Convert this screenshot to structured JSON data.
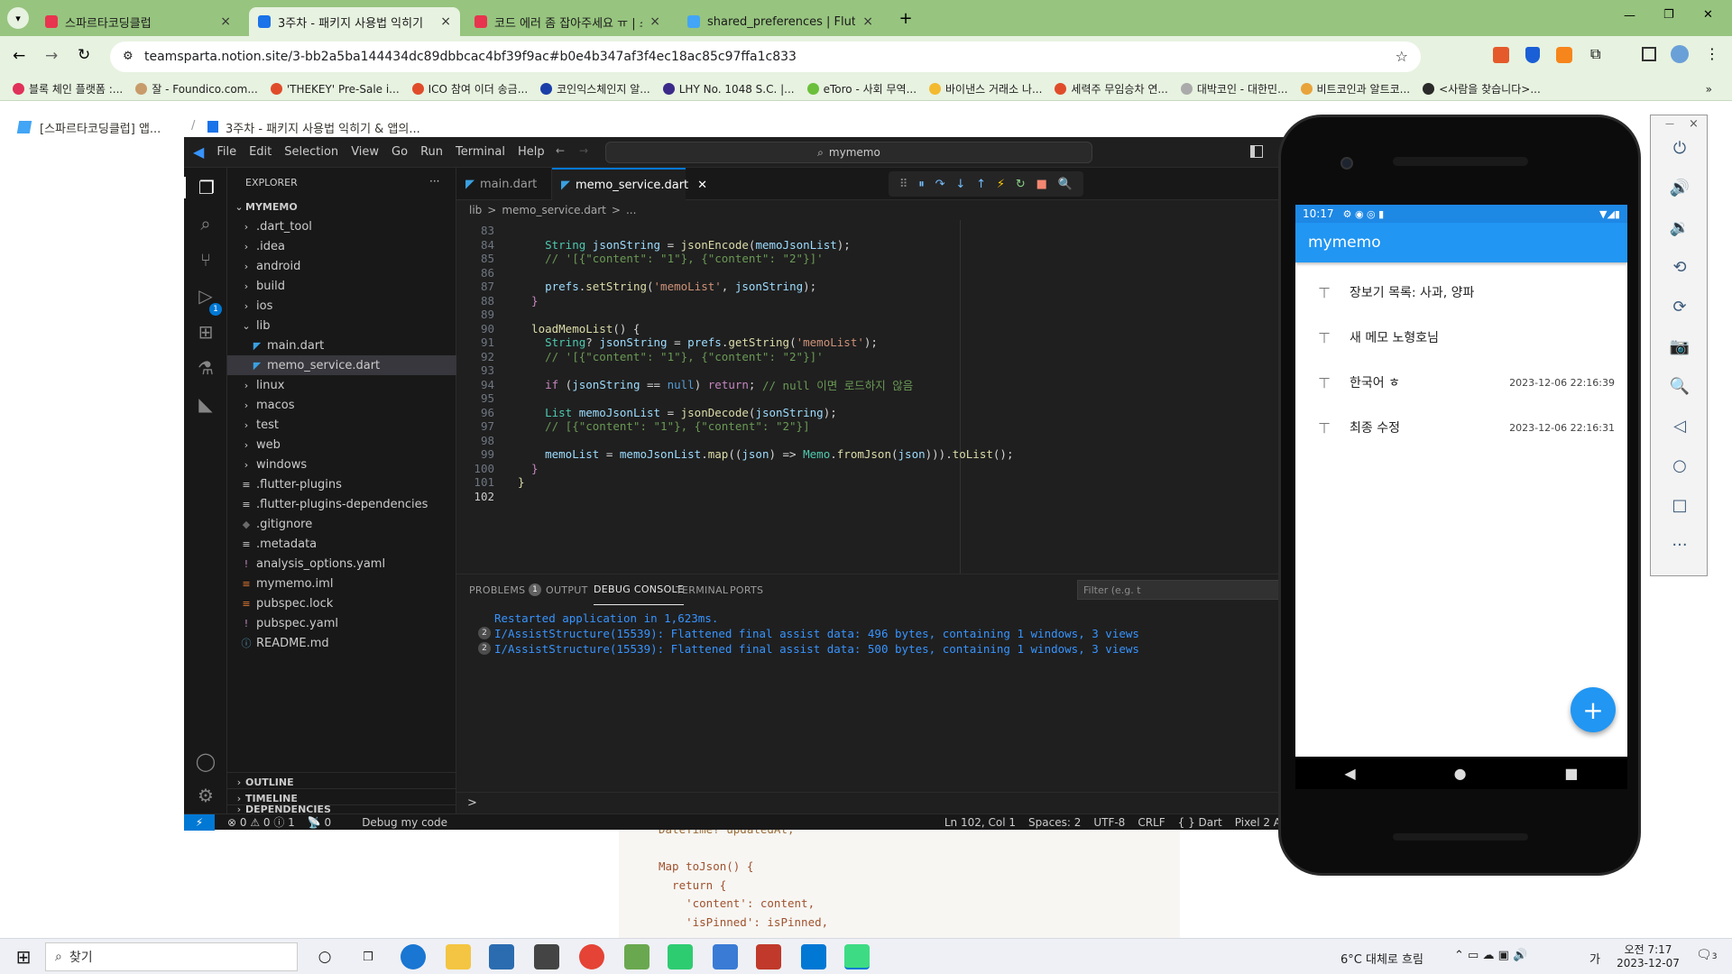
{
  "browser": {
    "tabs": [
      {
        "label": "스파르타코딩클럽",
        "color": "#e8344e"
      },
      {
        "label": "3주차 - 패키지 사용법 익히기",
        "color": "#1a73e8"
      },
      {
        "label": "코드 에러 좀 잡아주세요 ㅠ | 스",
        "color": "#e8344e"
      },
      {
        "label": "shared_preferences | Flutter Pa",
        "color": "#42a5f5"
      }
    ],
    "url": "teamsparta.notion.site/3-bb2a5ba144434dc89dbbcac4bf39f9ac#b0e4b347af3f4ec18ac85c97ffa1c833",
    "bookmarks": [
      {
        "label": "블록 체인 플랫폼 :...",
        "color": "#e0315a"
      },
      {
        "label": "잘 - Foundico.com...",
        "color": "#c89b6b"
      },
      {
        "label": "'THEKEY' Pre-Sale i...",
        "color": "#e04c2a"
      },
      {
        "label": "ICO 참여 이더 송금...",
        "color": "#e04c2a"
      },
      {
        "label": "코인익스체인지 알...",
        "color": "#1b3fa8"
      },
      {
        "label": "LHY No. 1048 S.C. |...",
        "color": "#3b2a8a"
      },
      {
        "label": "eToro - 사회 무역...",
        "color": "#6bbf3a"
      },
      {
        "label": "바이낸스 거래소 나...",
        "color": "#f3ba2f"
      },
      {
        "label": "세력주 무임승차 연...",
        "color": "#e04c2a"
      },
      {
        "label": "대박코인 - 대한민...",
        "color": "#aaaaaa"
      },
      {
        "label": "비트코인과 알트코...",
        "color": "#e8a33a"
      },
      {
        "label": "<사람을 찾습니다>...",
        "color": "#2a2a2a"
      }
    ],
    "tab_close": "×",
    "new_tab": "+",
    "win_min": "—",
    "win_restore": "❐",
    "win_close": "✕",
    "nav_back": "←",
    "nav_forward": "→",
    "nav_reload": "↻",
    "bookmark_more": "»"
  },
  "notion": {
    "breadcrumb_1": "[스파르타코딩클럽] 앱...",
    "breadcrumb_sep": "/",
    "breadcrumb_2": "3주차 - 패키지 사용법 익히기 & 앱의...",
    "code_lines": [
      "DateTime? updatedAt;",
      "",
      "Map toJson() {",
      "  return {",
      "    'content': content,",
      "    'isPinned': isPinned,"
    ]
  },
  "vscode": {
    "menu": [
      "File",
      "Edit",
      "Selection",
      "View",
      "Go",
      "Run",
      "Terminal",
      "Help"
    ],
    "command_center": "mymemo",
    "explorer_title": "EXPLORER",
    "explorer_more": "···",
    "project": "MYMEMO",
    "tree": [
      {
        "label": ".dart_tool",
        "type": "folder"
      },
      {
        "label": ".idea",
        "type": "folder"
      },
      {
        "label": "android",
        "type": "folder"
      },
      {
        "label": "build",
        "type": "folder"
      },
      {
        "label": "ios",
        "type": "folder"
      },
      {
        "label": "lib",
        "type": "folder-open"
      },
      {
        "label": "main.dart",
        "type": "dart"
      },
      {
        "label": "memo_service.dart",
        "type": "dart-sel"
      },
      {
        "label": "linux",
        "type": "folder"
      },
      {
        "label": "macos",
        "type": "folder"
      },
      {
        "label": "test",
        "type": "folder"
      },
      {
        "label": "web",
        "type": "folder"
      },
      {
        "label": "windows",
        "type": "folder"
      },
      {
        "label": ".flutter-plugins",
        "type": "file"
      },
      {
        "label": ".flutter-plugins-dependencies",
        "type": "file"
      },
      {
        "label": ".gitignore",
        "type": "git"
      },
      {
        "label": ".metadata",
        "type": "file"
      },
      {
        "label": "analysis_options.yaml",
        "type": "yaml"
      },
      {
        "label": "mymemo.iml",
        "type": "xml"
      },
      {
        "label": "pubspec.lock",
        "type": "xml"
      },
      {
        "label": "pubspec.yaml",
        "type": "yaml"
      },
      {
        "label": "README.md",
        "type": "info"
      }
    ],
    "sections": [
      "OUTLINE",
      "TIMELINE",
      "DEPENDENCIES"
    ],
    "tabs": [
      "main.dart",
      "memo_service.dart"
    ],
    "breadcrumb": [
      "lib",
      ">",
      "memo_service.dart",
      ">",
      "..."
    ],
    "code": [
      {
        "n": "83",
        "t": []
      },
      {
        "n": "84",
        "t": [
          [
            "ty",
            "    String "
          ],
          [
            "vr",
            "jsonString"
          ],
          [
            "pl",
            " = "
          ],
          [
            "fn",
            "jsonEncode"
          ],
          [
            "pl",
            "("
          ],
          [
            "vr",
            "memoJsonList"
          ],
          [
            "pl",
            ");"
          ]
        ]
      },
      {
        "n": "85",
        "t": [
          [
            "cm",
            "    // '[{\"content\": \"1\"}, {\"content\": \"2\"}]'"
          ]
        ]
      },
      {
        "n": "86",
        "t": []
      },
      {
        "n": "87",
        "t": [
          [
            "vr",
            "    prefs"
          ],
          [
            "pl",
            "."
          ],
          [
            "fn",
            "setString"
          ],
          [
            "pl",
            "("
          ],
          [
            "st",
            "'memoList'"
          ],
          [
            "pl",
            ", "
          ],
          [
            "vr",
            "jsonString"
          ],
          [
            "pl",
            ");"
          ]
        ]
      },
      {
        "n": "88",
        "t": [
          [
            "kc",
            "  }"
          ]
        ]
      },
      {
        "n": "89",
        "t": []
      },
      {
        "n": "90",
        "t": [
          [
            "fn",
            "  loadMemoList"
          ],
          [
            "pl",
            "() {"
          ]
        ]
      },
      {
        "n": "91",
        "t": [
          [
            "ty",
            "    String"
          ],
          [
            "pl",
            "? "
          ],
          [
            "vr",
            "jsonString"
          ],
          [
            "pl",
            " = "
          ],
          [
            "vr",
            "prefs"
          ],
          [
            "pl",
            "."
          ],
          [
            "fn",
            "getString"
          ],
          [
            "pl",
            "("
          ],
          [
            "st",
            "'memoList'"
          ],
          [
            "pl",
            ");"
          ]
        ]
      },
      {
        "n": "92",
        "t": [
          [
            "cm",
            "    // '[{\"content\": \"1\"}, {\"content\": \"2\"}]'"
          ]
        ]
      },
      {
        "n": "93",
        "t": []
      },
      {
        "n": "94",
        "t": [
          [
            "kc",
            "    if"
          ],
          [
            "pl",
            " ("
          ],
          [
            "vr",
            "jsonString"
          ],
          [
            "pl",
            " == "
          ],
          [
            "kw",
            "null"
          ],
          [
            "pl",
            ") "
          ],
          [
            "kc",
            "return"
          ],
          [
            "pl",
            "; "
          ],
          [
            "cm",
            "// null 이면 로드하지 않음"
          ]
        ]
      },
      {
        "n": "95",
        "t": []
      },
      {
        "n": "96",
        "t": [
          [
            "ty",
            "    List "
          ],
          [
            "vr",
            "memoJsonList"
          ],
          [
            "pl",
            " = "
          ],
          [
            "fn",
            "jsonDecode"
          ],
          [
            "pl",
            "("
          ],
          [
            "vr",
            "jsonString"
          ],
          [
            "pl",
            ");"
          ]
        ]
      },
      {
        "n": "97",
        "t": [
          [
            "cm",
            "    // [{\"content\": \"1\"}, {\"content\": \"2\"}]"
          ]
        ]
      },
      {
        "n": "98",
        "t": []
      },
      {
        "n": "99",
        "t": [
          [
            "vr",
            "    memoList"
          ],
          [
            "pl",
            " = "
          ],
          [
            "vr",
            "memoJsonList"
          ],
          [
            "pl",
            "."
          ],
          [
            "fn",
            "map"
          ],
          [
            "pl",
            "(("
          ],
          [
            "vr",
            "json"
          ],
          [
            "pl",
            ") => "
          ],
          [
            "ty",
            "Memo"
          ],
          [
            "pl",
            "."
          ],
          [
            "fn",
            "fromJson"
          ],
          [
            "pl",
            "("
          ],
          [
            "vr",
            "json"
          ],
          [
            "pl",
            ")))."
          ],
          [
            "fn",
            "toList"
          ],
          [
            "pl",
            "();"
          ]
        ]
      },
      {
        "n": "100",
        "t": [
          [
            "kc",
            "  }"
          ]
        ]
      },
      {
        "n": "101",
        "t": [
          [
            "fn",
            "}"
          ]
        ]
      },
      {
        "n": "102",
        "t": []
      }
    ],
    "panel_tabs": [
      "PROBLEMS",
      "OUTPUT",
      "DEBUG CONSOLE",
      "TERMINAL",
      "PORTS"
    ],
    "problems_count": "1",
    "filter_placeholder": "Filter (e.g. t",
    "console": [
      {
        "count": "",
        "text": "Restarted application in 1,623ms."
      },
      {
        "count": "2",
        "text": "I/AssistStructure(15539): Flattened final assist data: 496 bytes, containing 1 windows, 3 views"
      },
      {
        "count": "2",
        "text": "I/AssistStructure(15539): Flattened final assist data: 500 bytes, containing 1 windows, 3 views"
      }
    ],
    "console_prompt": ">",
    "status": {
      "remote": "⚡",
      "errors": "⊗ 0 ⚠ 0 ⓘ 1",
      "ports": "📡 0",
      "debug": "Debug my code",
      "cursor": "Ln 102, Col 1",
      "spaces": "Spaces: 2",
      "encoding": "UTF-8",
      "eol": "CRLF",
      "lang": "{ } Dart",
      "device": "Pixel 2 A"
    },
    "debug_buttons": [
      "⠿",
      "⏸",
      "↷",
      "↓",
      "↑",
      "⚡",
      "↻",
      "■",
      "🔍"
    ],
    "accent": "#0078d4"
  },
  "phone": {
    "time": "10:17",
    "status_icons": "⚙ ◉ ◎ ▮",
    "status_right": "▼◢▮",
    "title": "mymemo",
    "memos": [
      {
        "text": "장보기 목록: 사과, 양파",
        "date": ""
      },
      {
        "text": "새 메모 노형호님",
        "date": ""
      },
      {
        "text": "한국어 ㅎ",
        "date": "2023-12-06 22:16:39"
      },
      {
        "text": "최종 수정",
        "date": "2023-12-06 22:16:31"
      }
    ],
    "pin_icon": "📌",
    "fab": "+",
    "nav": [
      "◀",
      "●",
      "■"
    ],
    "accent": "#2196f3"
  },
  "emulator_tools": [
    "⏻",
    "🔊",
    "🔉",
    "⟲",
    "⟳",
    "📷",
    "🔍",
    "◁",
    "○",
    "□",
    "···"
  ],
  "emulator_close": "×",
  "emulator_min": "—",
  "taskbar": {
    "search": "찾기",
    "weather": "6°C  대체로 흐림",
    "time": "오전 7:17",
    "date": "2023-12-07",
    "notif": "3",
    "lang": "가"
  }
}
